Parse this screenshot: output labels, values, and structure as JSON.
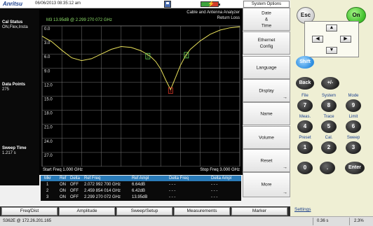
{
  "header": {
    "brand": "Anritsu",
    "datetime": "06/06/2013 08:35:12 am",
    "battery_level": 0.55
  },
  "left_panel": {
    "cal_title": "Cal Status",
    "cal_value": "ON,Flex,Insta",
    "dp_title": "Data Points",
    "dp_value": "275",
    "sweep_title": "Sweep Time",
    "sweep_value": "1.217 s"
  },
  "plot": {
    "title_line1": "Cable and Antenna Analyzer",
    "title_line2": "Return Loss",
    "marker_readout": "M3  13.95dB @ 2.299 270 072 GHz",
    "start_freq": "Start Freq 1.000 GHz",
    "stop_freq": "Stop Freq 3.000 GHz"
  },
  "chart_data": {
    "type": "line",
    "ylabels": [
      "0.0",
      "3.0",
      "6.0",
      "9.0",
      "12.0",
      "15.0",
      "18.0",
      "21.0",
      "24.0",
      "27.0"
    ],
    "xlim": [
      1.0,
      3.0
    ],
    "ylim": [
      0,
      30
    ],
    "grid": true,
    "x": [
      1.0,
      1.1,
      1.2,
      1.3,
      1.4,
      1.5,
      1.6,
      1.7,
      1.8,
      1.9,
      2.0,
      2.05,
      2.1,
      2.15,
      2.2,
      2.25,
      2.3,
      2.35,
      2.4,
      2.45,
      2.5,
      2.6,
      2.7,
      2.8,
      2.9,
      3.0
    ],
    "y": [
      2.2,
      3.4,
      5.2,
      6.8,
      7.4,
      7.0,
      6.0,
      5.0,
      4.4,
      4.6,
      5.3,
      5.9,
      6.6,
      7.6,
      9.2,
      11.5,
      13.6,
      11.0,
      8.4,
      6.4,
      5.0,
      3.2,
      1.8,
      0.9,
      0.4,
      0.2
    ],
    "markers": [
      {
        "label": "1",
        "x": 2.07,
        "y": 6.6
      },
      {
        "label": "2",
        "x": 2.46,
        "y": 6.4
      },
      {
        "label": "3",
        "x": 2.3,
        "y": 13.95
      }
    ],
    "trace_color": "#e8e05a",
    "marker_color": "#6bd85a",
    "active_marker_color": "#e03a2a"
  },
  "marker_table": {
    "headers": [
      "Mkr",
      "Ref",
      "Delta",
      "Ref Freq",
      "Ref Ampl",
      "Delta Freq",
      "Delta Ampl"
    ],
    "rows": [
      [
        "1",
        "ON",
        "OFF",
        "2.072 992 700 GHz",
        "6.64dB",
        "- - -",
        "- - -"
      ],
      [
        "2",
        "ON",
        "OFF",
        "2.459 854 014 GHz",
        "6.42dB",
        "- - -",
        "- - -"
      ],
      [
        "3",
        "ON",
        "OFF",
        "2.299 270 072 GHz",
        "13.95dB",
        "- - -",
        "- - -"
      ]
    ]
  },
  "menu": {
    "title": "System Options",
    "items": [
      {
        "label": "Date\n&\nTime",
        "arrow": false
      },
      {
        "label": "Ethernet\nConfig",
        "arrow": false
      },
      {
        "label": "Language",
        "arrow": false
      },
      {
        "label": "Display",
        "arrow": true
      },
      {
        "label": "Name",
        "arrow": false
      },
      {
        "label": "Volume",
        "arrow": false
      },
      {
        "label": "Reset",
        "arrow": true
      },
      {
        "label": "More",
        "arrow": true
      }
    ]
  },
  "tabs": [
    "Freq/Dist",
    "Amplitude",
    "Sweep/Setup",
    "Measurements",
    "Marker"
  ],
  "status": {
    "device": "S362E @ 172.26.201.165",
    "time": "0.36 s",
    "percent": "2.3%"
  },
  "keypad": {
    "esc": "Esc",
    "on": "On",
    "shift": "Shift",
    "back": "Back",
    "plusminus": "+/-",
    "keys": [
      {
        "top": "File",
        "num": "7"
      },
      {
        "top": "System",
        "num": "8"
      },
      {
        "top": "Mode",
        "num": "9"
      },
      {
        "top": "Meas.",
        "num": "4"
      },
      {
        "top": "Trace",
        "num": "5"
      },
      {
        "top": "Limit",
        "num": "6"
      },
      {
        "top": "Preset",
        "num": "1"
      },
      {
        "top": "Cal.",
        "num": "2"
      },
      {
        "top": "Sweep",
        "num": "3"
      }
    ],
    "zero": "0",
    "dot": ".",
    "enter": "Enter",
    "settings": "Settings"
  }
}
